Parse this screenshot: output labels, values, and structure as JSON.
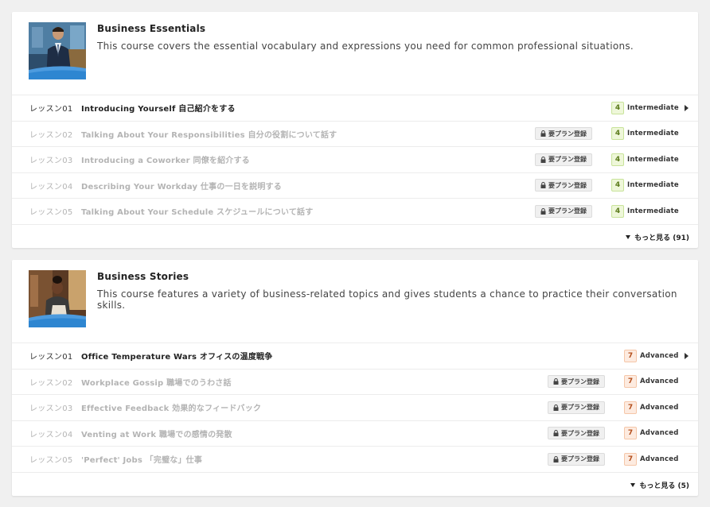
{
  "courses": [
    {
      "title": "Business Essentials",
      "description": "This course covers the essential vocabulary and expressions you need for common professional situations.",
      "thumbnail": "businessman-portrait",
      "level_number": "4",
      "level_label": "Intermediate",
      "level_color": "#eef7d9",
      "lessons": [
        {
          "num": "レッスン01",
          "title": "Introducing Yourself 自己紹介をする",
          "locked": false
        },
        {
          "num": "レッスン02",
          "title": "Talking About Your Responsibilities 自分の役割について話す",
          "locked": true,
          "badge": "要プラン登録"
        },
        {
          "num": "レッスン03",
          "title": "Introducing a Coworker 同僚を紹介する",
          "locked": true,
          "badge": "要プラン登録"
        },
        {
          "num": "レッスン04",
          "title": "Describing Your Workday 仕事の一日を説明する",
          "locked": true,
          "badge": "要プラン登録"
        },
        {
          "num": "レッスン05",
          "title": "Talking About Your Schedule スケジュールについて話す",
          "locked": true,
          "badge": "要プラン登録"
        }
      ],
      "more_label": "もっと見る (91)"
    },
    {
      "title": "Business Stories",
      "description": "This course features a variety of business-related topics and gives students a chance to practice their conversation skills.",
      "thumbnail": "businesswoman-reading",
      "level_number": "7",
      "level_label": "Advanced",
      "level_color": "#fdebe0",
      "lessons": [
        {
          "num": "レッスン01",
          "title": "Office Temperature Wars オフィスの温度戦争",
          "locked": false
        },
        {
          "num": "レッスン02",
          "title": "Workplace Gossip 職場でのうわさ話",
          "locked": true,
          "badge": "要プラン登録"
        },
        {
          "num": "レッスン03",
          "title": "Effective Feedback 効果的なフィードバック",
          "locked": true,
          "badge": "要プラン登録"
        },
        {
          "num": "レッスン04",
          "title": "Venting at Work 職場での感情の発散",
          "locked": true,
          "badge": "要プラン登録"
        },
        {
          "num": "レッスン05",
          "title": "'Perfect' Jobs 「完璧な」仕事",
          "locked": true,
          "badge": "要プラン登録"
        }
      ],
      "more_label": "もっと見る (5)"
    }
  ]
}
